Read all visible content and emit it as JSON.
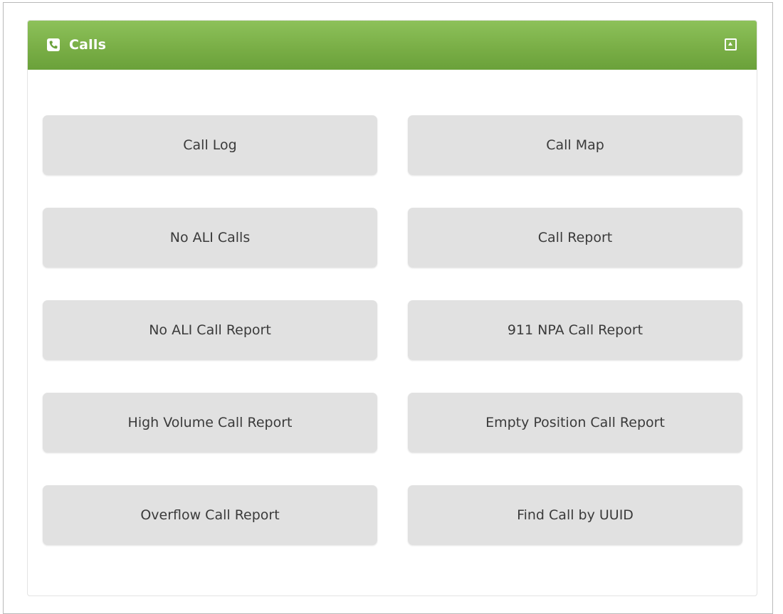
{
  "panel": {
    "title": "Calls",
    "header_color": "#7cb24a",
    "icons": {
      "header": "phone-icon",
      "collapse": "collapse-icon"
    }
  },
  "buttons": [
    {
      "label": "Call Log"
    },
    {
      "label": "Call Map"
    },
    {
      "label": "No ALI Calls"
    },
    {
      "label": "Call Report"
    },
    {
      "label": "No ALI Call Report"
    },
    {
      "label": "911 NPA Call Report"
    },
    {
      "label": "High Volume Call Report"
    },
    {
      "label": "Empty Position Call Report"
    },
    {
      "label": "Overflow Call Report"
    },
    {
      "label": "Find Call by UUID"
    }
  ]
}
